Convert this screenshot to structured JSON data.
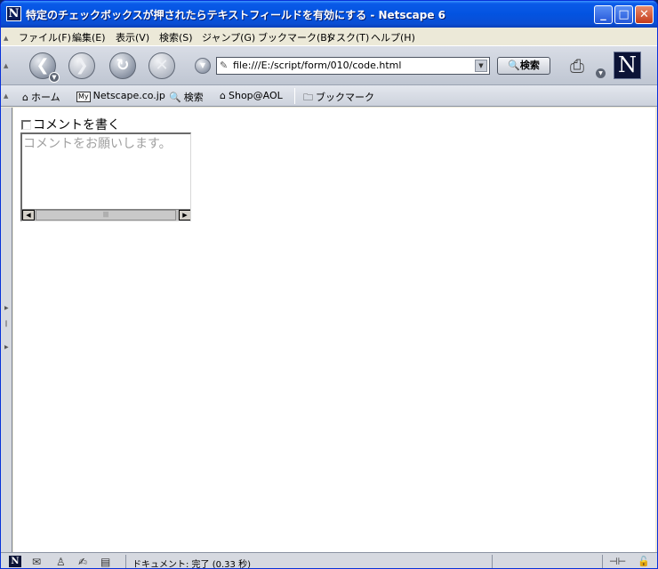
{
  "window": {
    "app_icon": "N",
    "title": "特定のチェックボックスが押されたらテキストフィールドを有効にする - Netscape 6"
  },
  "menubar": {
    "items": [
      "ファイル(F)",
      "編集(E)",
      "表示(V)",
      "検索(S)",
      "ジャンプ(G)",
      "ブックマーク(B)",
      "タスク(T)",
      "ヘルプ(H)"
    ]
  },
  "navbar": {
    "url": "file:///E:/script/form/010/code.html",
    "search_label": "検索",
    "throbber": "N"
  },
  "personal_toolbar": {
    "home": "ホーム",
    "my_badge": "My",
    "netscape": "Netscape.co.jp",
    "search": "検索",
    "shop": "Shop@AOL",
    "bookmarks": "ブックマーク"
  },
  "content": {
    "checkbox_label": "コメントを書く",
    "checkbox_checked": false,
    "textarea_placeholder": "コメントをお願いします。"
  },
  "statusbar": {
    "text": "ドキュメント: 完了 (0.33 秒)"
  },
  "icons": [
    "back-icon",
    "forward-icon",
    "reload-icon",
    "stop-icon",
    "print-icon",
    "home-icon",
    "search-icon",
    "shop-icon",
    "folder-icon",
    "mail-icon",
    "composer-icon"
  ],
  "colors": {
    "titlebar": "#0353e0",
    "close": "#c43c1c"
  }
}
